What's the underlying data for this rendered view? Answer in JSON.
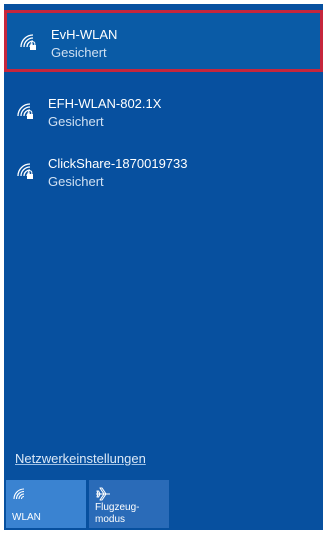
{
  "networks": [
    {
      "name": "EvH-WLAN",
      "status": "Gesichert",
      "icon": "wifi-secured-icon",
      "selected": true
    },
    {
      "name": "EFH-WLAN-802.1X",
      "status": "Gesichert",
      "icon": "wifi-secured-icon",
      "selected": false
    },
    {
      "name": "ClickShare-1870019733",
      "status": "Gesichert",
      "icon": "wifi-secured-icon",
      "selected": false
    }
  ],
  "settings_link": "Netzwerkeinstellungen",
  "quick_actions": {
    "wlan": {
      "label": "WLAN",
      "icon": "wifi-icon"
    },
    "flight_mode": {
      "label_line1": "Flugzeug-",
      "label_line2": "modus",
      "icon": "airplane-icon"
    }
  },
  "colors": {
    "panel_background": "#07509f",
    "selected_border": "#c6263c",
    "wlan_tile_active": "#3a83d1",
    "flight_tile": "#2a6bb8"
  }
}
